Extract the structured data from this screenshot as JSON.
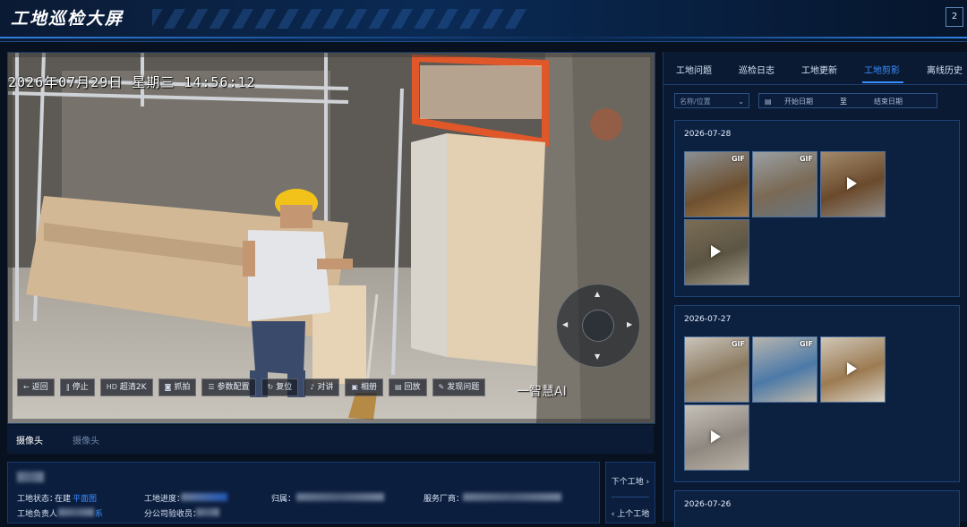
{
  "app": {
    "title": "工地巡检大屏",
    "fullscreen_glyph": "2"
  },
  "video": {
    "osd_time": "2026年07月29日  星期三  14:56:12",
    "watermark": "一智慧AI",
    "toolbar": [
      {
        "icon": "back-icon",
        "glyph": "←",
        "label": "返回"
      },
      {
        "icon": "pause-icon",
        "glyph": "‖",
        "label": "停止"
      },
      {
        "icon": "hd-icon",
        "glyph": "HD",
        "label": "超清2K"
      },
      {
        "icon": "camera-icon",
        "glyph": "◙",
        "label": "抓拍"
      },
      {
        "icon": "settings-icon",
        "glyph": "☰",
        "label": "参数配置"
      },
      {
        "icon": "reset-icon",
        "glyph": "↻",
        "label": "复位"
      },
      {
        "icon": "mic-icon",
        "glyph": "♪",
        "label": "对讲"
      },
      {
        "icon": "album-icon",
        "glyph": "▣",
        "label": "相册"
      },
      {
        "icon": "playback-icon",
        "glyph": "▤",
        "label": "回放"
      },
      {
        "icon": "report-icon",
        "glyph": "✎",
        "label": "发现问题"
      }
    ]
  },
  "camera_tabs": [
    {
      "label": "摄像头",
      "active": true
    },
    {
      "label": "摄像头",
      "active": false
    }
  ],
  "site_info": {
    "status_label": "工地状态：",
    "status_value": "在建",
    "plan_link": "平面图",
    "progress_label": "工地进度：",
    "belong_label": "归属：",
    "vendor_label": "服务厂商：",
    "manager_label": "工地负责人",
    "manager_suffix": "系",
    "inspector_label": "分公司验收员："
  },
  "site_nav": {
    "next": "下个工地",
    "prev": "上个工地"
  },
  "right_panel": {
    "tabs": [
      {
        "label": "工地问题",
        "active": false
      },
      {
        "label": "巡检日志",
        "active": false
      },
      {
        "label": "工地更新",
        "active": false
      },
      {
        "label": "工地剪影",
        "active": true
      },
      {
        "label": "离线历史",
        "active": false
      }
    ],
    "filter": {
      "name_placeholder": "名称/位置",
      "start_placeholder": "开始日期",
      "separator": "至",
      "end_placeholder": "结束日期"
    },
    "days": [
      {
        "date": "2026-07-28",
        "thumbs": [
          {
            "type": "GIF"
          },
          {
            "type": "GIF"
          },
          {
            "type": "video"
          },
          {
            "type": "video"
          }
        ]
      },
      {
        "date": "2026-07-27",
        "thumbs": [
          {
            "type": "GIF"
          },
          {
            "type": "GIF"
          },
          {
            "type": "video"
          },
          {
            "type": "video"
          }
        ]
      },
      {
        "date": "2026-07-26",
        "thumbs": []
      }
    ]
  },
  "colors": {
    "accent": "#3a8cff",
    "panel": "#0c1e3e",
    "background": "#07111f"
  }
}
